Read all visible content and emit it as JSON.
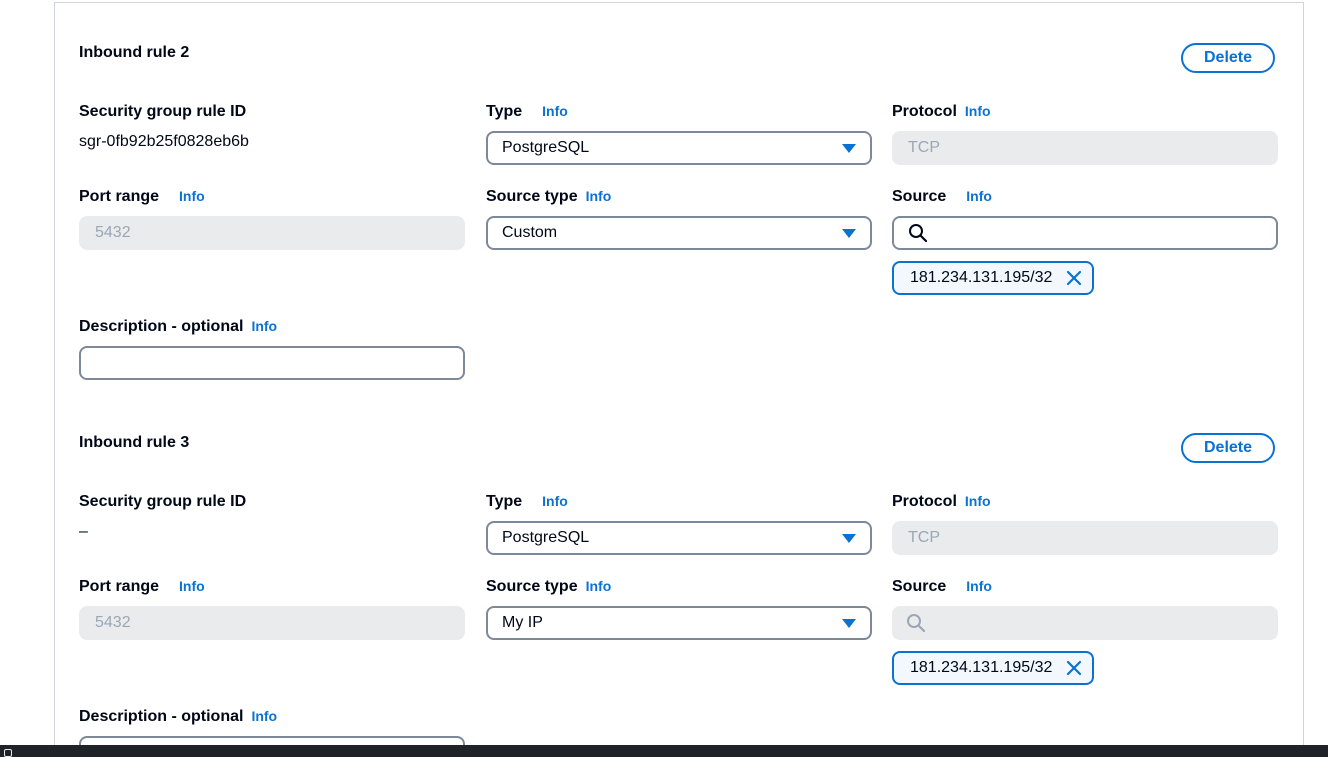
{
  "info_label": "Info",
  "rules": [
    {
      "title": "Inbound rule 2",
      "delete_label": "Delete",
      "rule_id_label": "Security group rule ID",
      "rule_id_value": "sgr-0fb92b25f0828eb6b",
      "type_label": "Type",
      "type_value": "PostgreSQL",
      "protocol_label": "Protocol",
      "protocol_value": "TCP",
      "port_label": "Port range",
      "port_value": "5432",
      "source_type_label": "Source type",
      "source_type_value": "Custom",
      "source_label": "Source",
      "source_search_disabled": false,
      "source_token": "181.234.131.195/32",
      "description_label": "Description - optional",
      "description_value": ""
    },
    {
      "title": "Inbound rule 3",
      "delete_label": "Delete",
      "rule_id_label": "Security group rule ID",
      "rule_id_value": "–",
      "type_label": "Type",
      "type_value": "PostgreSQL",
      "protocol_label": "Protocol",
      "protocol_value": "TCP",
      "port_label": "Port range",
      "port_value": "5432",
      "source_type_label": "Source type",
      "source_type_value": "My IP",
      "source_label": "Source",
      "source_search_disabled": true,
      "source_token": "181.234.131.195/32",
      "description_label": "Description - optional",
      "description_value": ""
    }
  ],
  "colors": {
    "accent": "#0972d3",
    "disabled_bg": "#e9ebed",
    "border": "#7d8998"
  },
  "icons": {
    "dropdown": "caret-down-icon",
    "search": "search-icon",
    "remove": "close-icon"
  }
}
